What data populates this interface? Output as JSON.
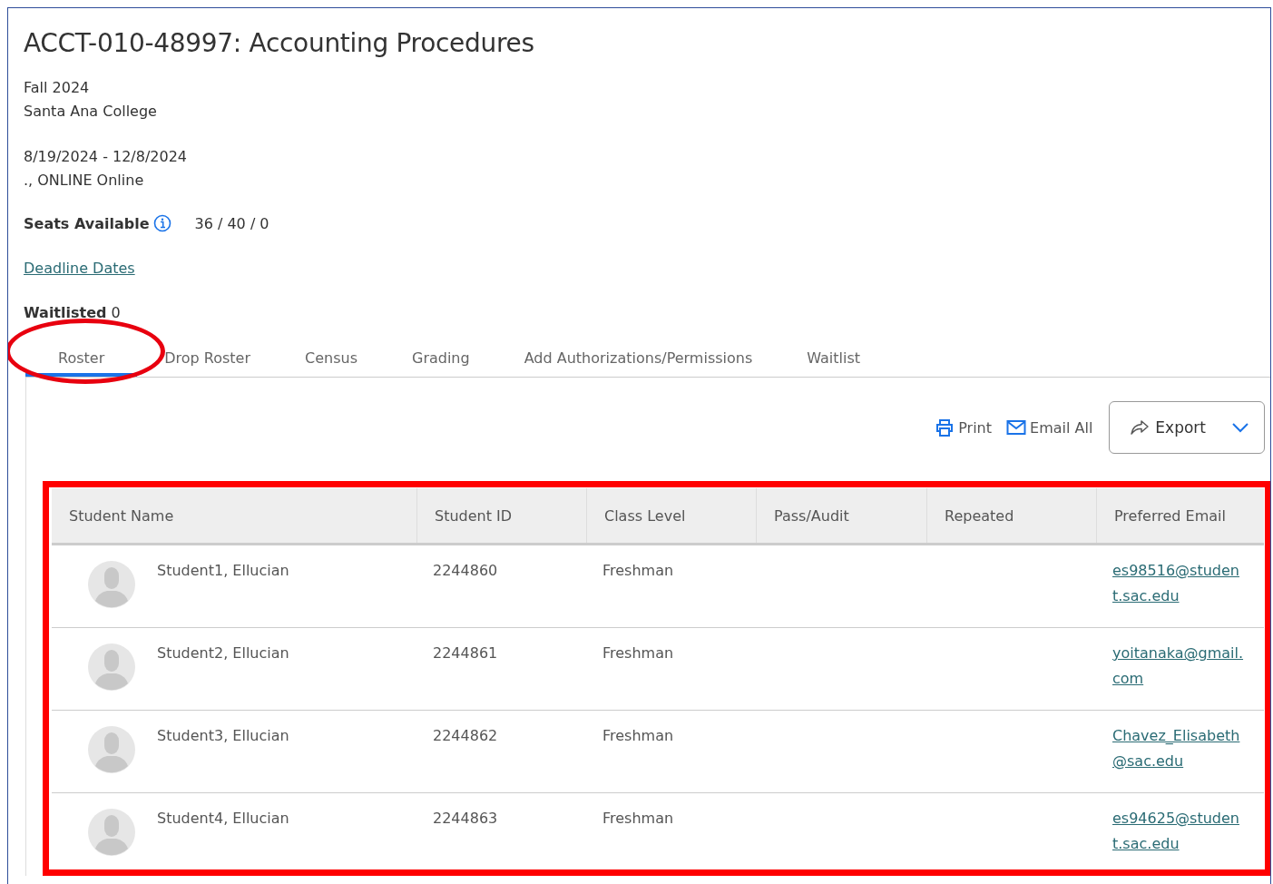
{
  "course": {
    "title": "ACCT-010-48997: Accounting Procedures",
    "term": "Fall 2024",
    "college": "Santa Ana College",
    "dates": "8/19/2024 - 12/8/2024",
    "location": "., ONLINE Online"
  },
  "seats": {
    "label": "Seats Available",
    "value": "36 / 40 / 0"
  },
  "deadline_link": "Deadline Dates",
  "waitlisted": "**Waitlisted** 0",
  "tabs": [
    {
      "label": "Roster",
      "selected": true
    },
    {
      "label": "Drop Roster",
      "selected": false
    },
    {
      "label": "Census",
      "selected": false
    },
    {
      "label": "Grading",
      "selected": false
    },
    {
      "label": "Add Authorizations/Permissions",
      "selected": false
    },
    {
      "label": "Waitlist",
      "selected": false
    }
  ],
  "toolbar": {
    "print": "Print",
    "email_all": "Email All",
    "export": "Export"
  },
  "table": {
    "columns": [
      "Student Name",
      "Student ID",
      "Class Level",
      "Pass/Audit",
      "Repeated",
      "Preferred Email"
    ],
    "rows": [
      {
        "name": "Student1, Ellucian",
        "student_id": "2244860",
        "class_level": "Freshman",
        "email": "es98516@student.sac.edu"
      },
      {
        "name": "Student2, Ellucian",
        "student_id": "2244861",
        "class_level": "Freshman",
        "email": "yoitanaka@gmail.com"
      },
      {
        "name": "Student3, Ellucian",
        "student_id": "2244862",
        "class_level": "Freshman",
        "email": "Chavez_Elisabeth@sac.edu"
      },
      {
        "name": "Student4, Ellucian",
        "student_id": "2244863",
        "class_level": "Freshman",
        "email": "es94625@student.sac.edu"
      }
    ]
  }
}
